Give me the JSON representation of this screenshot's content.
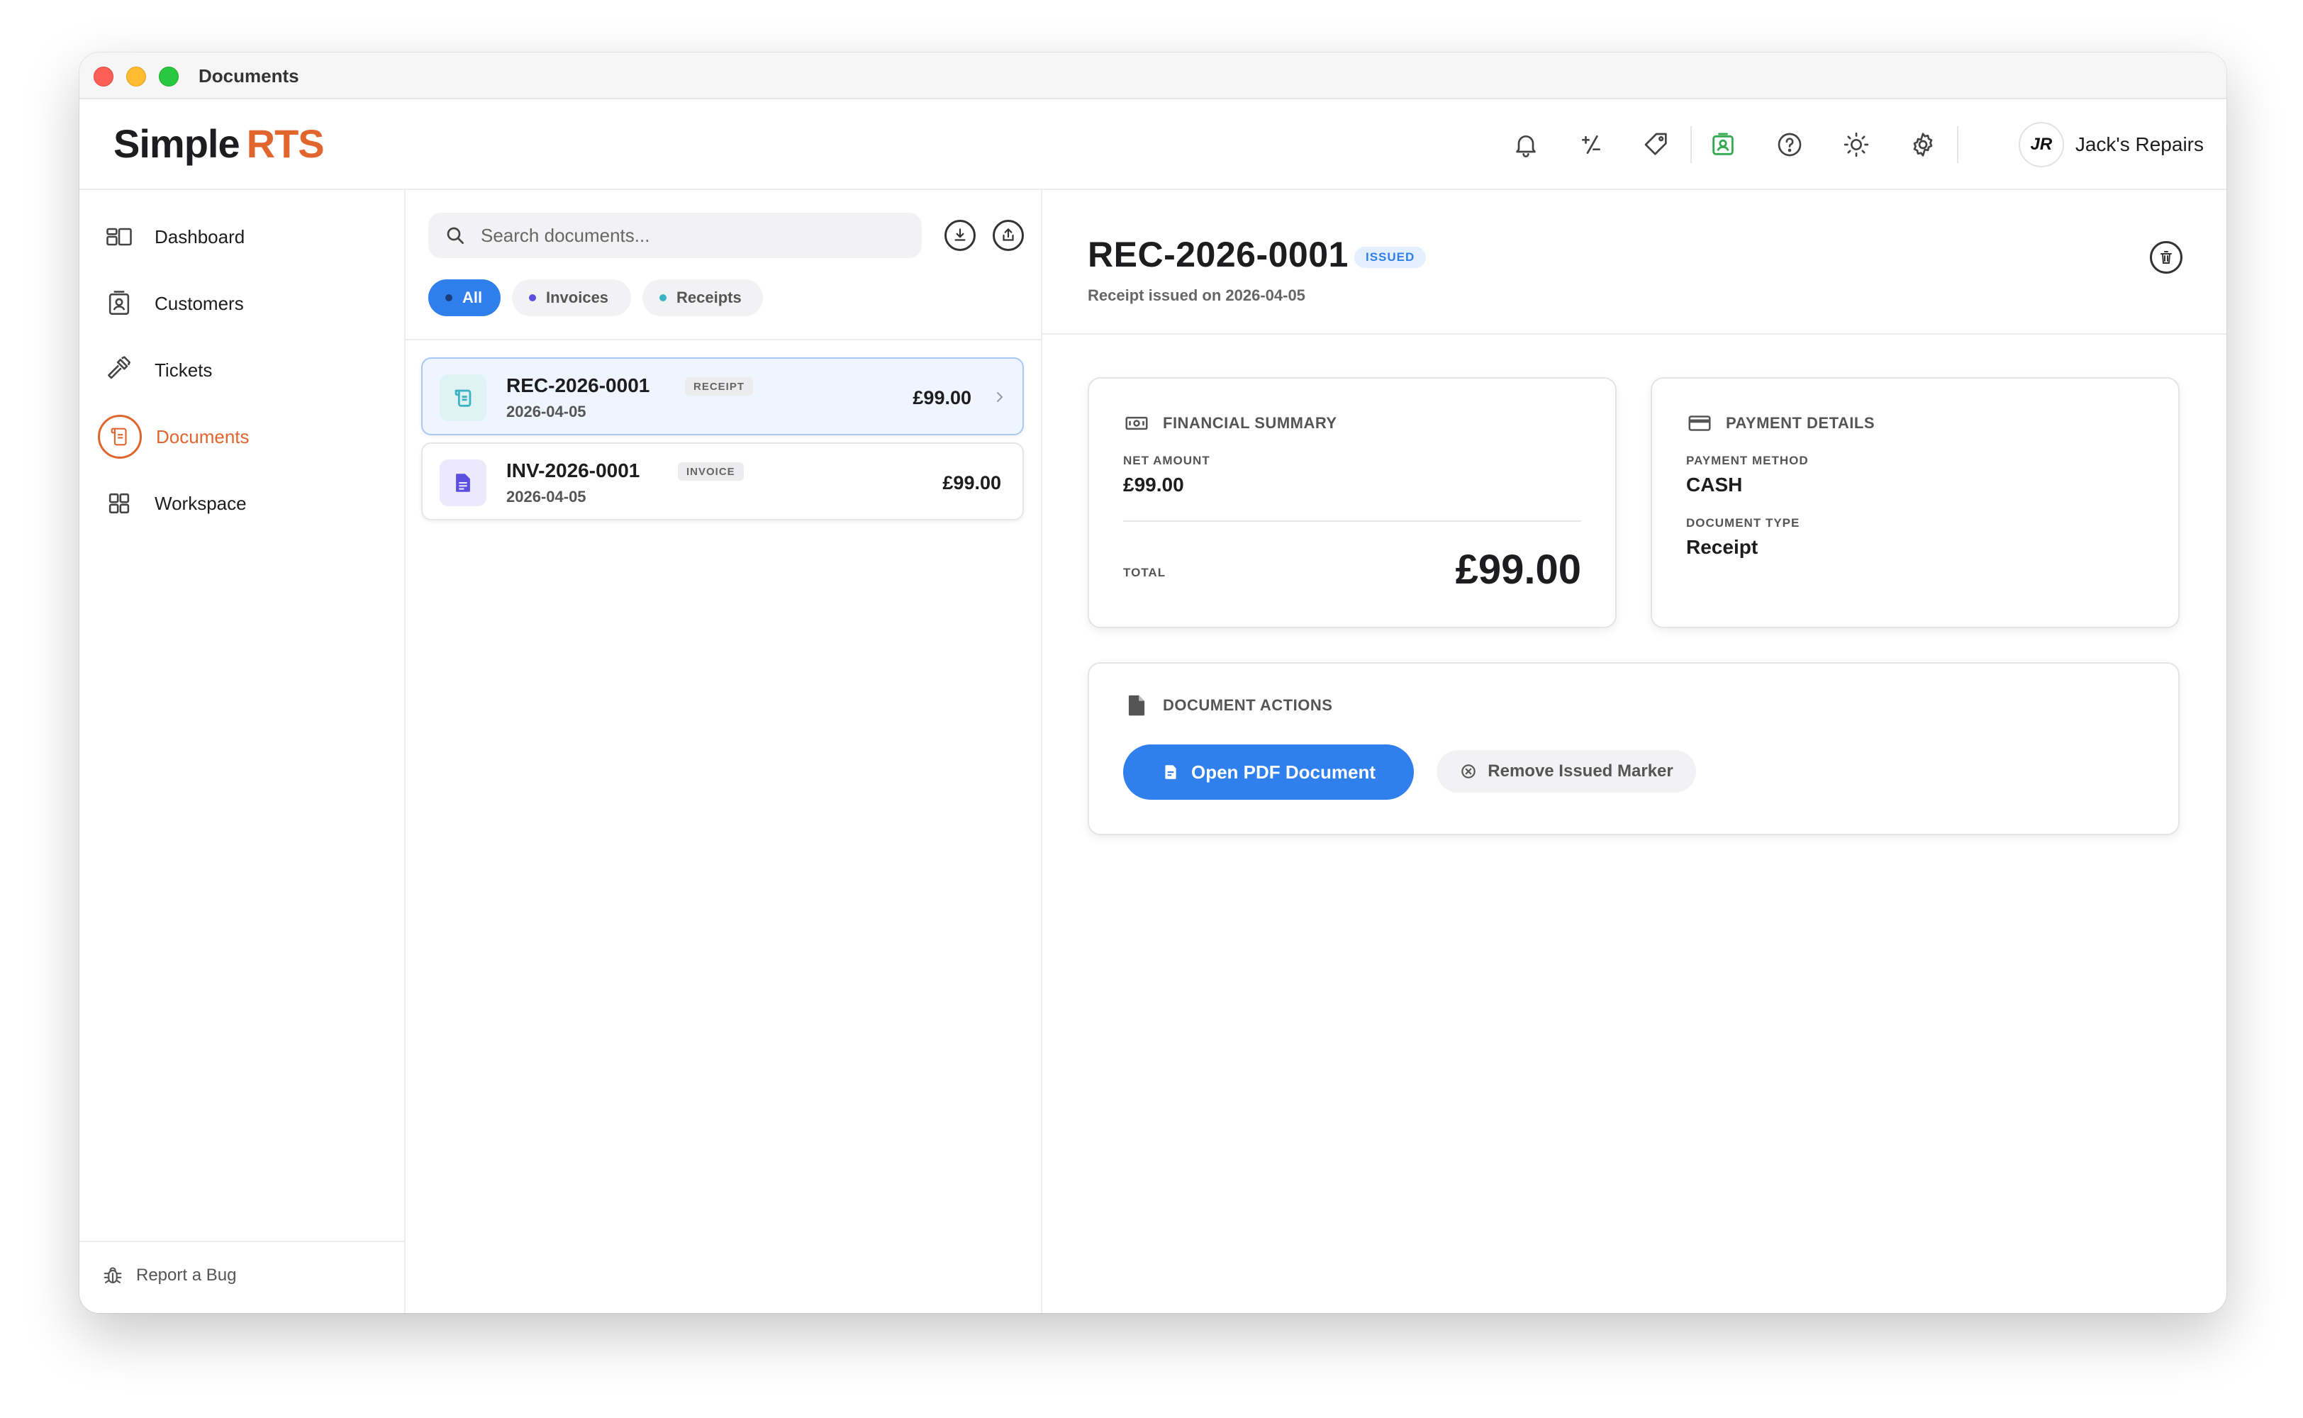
{
  "window": {
    "title": "Documents"
  },
  "brand": {
    "part1": "Simple",
    "part2": "RTS"
  },
  "header": {
    "icons": [
      "bell-icon",
      "percent-icon",
      "tag-icon",
      "contact-icon",
      "help-icon",
      "sun-icon",
      "gear-icon"
    ],
    "profile": {
      "logo": "JR",
      "name": "Jack's Repairs"
    }
  },
  "sidebar": {
    "items": [
      {
        "label": "Dashboard",
        "icon": "dashboard-icon"
      },
      {
        "label": "Customers",
        "icon": "customers-icon"
      },
      {
        "label": "Tickets",
        "icon": "hammer-icon"
      },
      {
        "label": "Documents",
        "icon": "document-icon",
        "active": true
      },
      {
        "label": "Workspace",
        "icon": "grid-icon"
      }
    ],
    "report_bug": "Report a Bug"
  },
  "list": {
    "search_placeholder": "Search documents...",
    "filters": [
      {
        "label": "All",
        "active": true
      },
      {
        "label": "Invoices",
        "dot": "#5b4fe0"
      },
      {
        "label": "Receipts",
        "dot": "#3bb3c4"
      }
    ],
    "documents": [
      {
        "number": "REC-2026-0001",
        "type": "RECEIPT",
        "date": "2026-04-05",
        "amount": "£99.00",
        "selected": true
      },
      {
        "number": "INV-2026-0001",
        "type": "INVOICE",
        "date": "2026-04-05",
        "amount": "£99.00",
        "selected": false
      }
    ]
  },
  "detail": {
    "title": "REC-2026-0001",
    "status": "ISSUED",
    "subtitle": "Receipt issued on 2026-04-05",
    "financial": {
      "heading": "FINANCIAL SUMMARY",
      "net_label": "NET AMOUNT",
      "net_value": "£99.00",
      "total_label": "TOTAL",
      "total_value": "£99.00"
    },
    "payment": {
      "heading": "PAYMENT DETAILS",
      "method_label": "PAYMENT METHOD",
      "method_value": "CASH",
      "type_label": "DOCUMENT TYPE",
      "type_value": "Receipt"
    },
    "actions": {
      "heading": "DOCUMENT ACTIONS",
      "primary": "Open PDF Document",
      "secondary": "Remove Issued Marker"
    }
  },
  "colors": {
    "accent": "#2f7fed",
    "brand": "#e0662d",
    "green": "#34a853"
  }
}
